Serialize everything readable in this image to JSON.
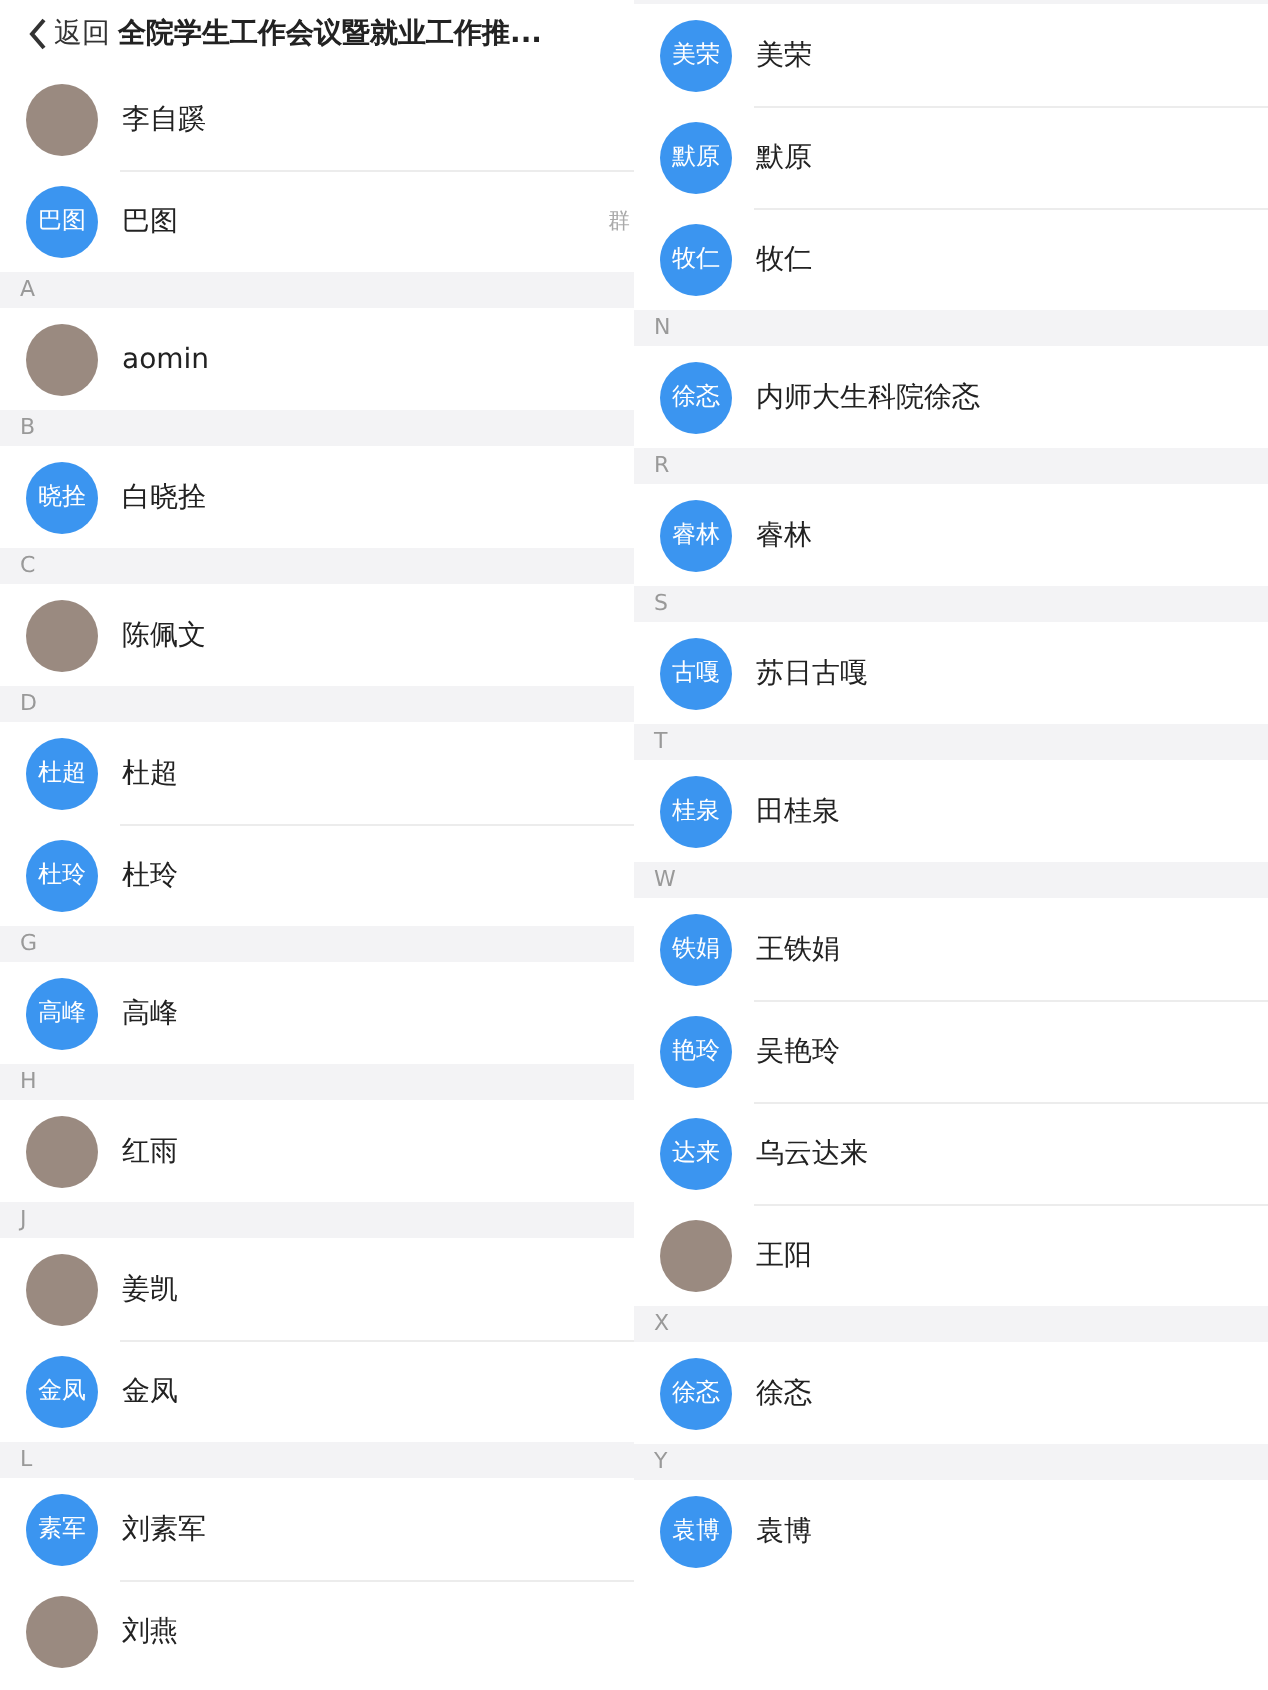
{
  "panels": [
    {
      "header": {
        "back_label": "返回",
        "title": "全院学生工作会议暨就业工作推..."
      },
      "sections": [
        {
          "contacts": [
            {
              "name": "李自蹊",
              "avatar": {
                "kind": "photo"
              }
            },
            {
              "name": "巴图",
              "avatar": {
                "kind": "initials",
                "text": "巴图"
              },
              "side_label": "群"
            }
          ]
        },
        {
          "letter": "A",
          "contacts": [
            {
              "name": "aomin",
              "avatar": {
                "kind": "photo"
              }
            }
          ]
        },
        {
          "letter": "B",
          "contacts": [
            {
              "name": "白晓拴",
              "avatar": {
                "kind": "initials",
                "text": "晓拴"
              }
            }
          ]
        },
        {
          "letter": "C",
          "contacts": [
            {
              "name": "陈佩文",
              "avatar": {
                "kind": "photo"
              }
            }
          ]
        },
        {
          "letter": "D",
          "contacts": [
            {
              "name": "杜超",
              "avatar": {
                "kind": "initials",
                "text": "杜超"
              }
            },
            {
              "name": "杜玲",
              "avatar": {
                "kind": "initials",
                "text": "杜玲"
              }
            }
          ]
        },
        {
          "letter": "G",
          "contacts": [
            {
              "name": "高峰",
              "avatar": {
                "kind": "initials",
                "text": "高峰"
              }
            }
          ]
        },
        {
          "letter": "H",
          "contacts": [
            {
              "name": "红雨",
              "avatar": {
                "kind": "photo"
              }
            }
          ]
        },
        {
          "letter": "J",
          "contacts": [
            {
              "name": "姜凯",
              "avatar": {
                "kind": "photo"
              }
            },
            {
              "name": "金凤",
              "avatar": {
                "kind": "initials",
                "text": "金凤"
              }
            }
          ]
        },
        {
          "letter": "L",
          "contacts": [
            {
              "name": "刘素军",
              "avatar": {
                "kind": "initials",
                "text": "素军"
              }
            },
            {
              "name": "刘燕",
              "avatar": {
                "kind": "photo"
              }
            }
          ]
        }
      ]
    },
    {
      "sections": [
        {
          "contacts": [
            {
              "name": "美荣",
              "avatar": {
                "kind": "initials",
                "text": "美荣"
              }
            },
            {
              "name": "默原",
              "avatar": {
                "kind": "initials",
                "text": "默原"
              }
            },
            {
              "name": "牧仁",
              "avatar": {
                "kind": "initials",
                "text": "牧仁"
              }
            }
          ]
        },
        {
          "letter": "N",
          "contacts": [
            {
              "name": "内师大生科院徐忞",
              "avatar": {
                "kind": "initials",
                "text": "徐忞"
              }
            }
          ]
        },
        {
          "letter": "R",
          "contacts": [
            {
              "name": "睿林",
              "avatar": {
                "kind": "initials",
                "text": "睿林"
              }
            }
          ]
        },
        {
          "letter": "S",
          "contacts": [
            {
              "name": "苏日古嘎",
              "avatar": {
                "kind": "initials",
                "text": "古嘎"
              }
            }
          ]
        },
        {
          "letter": "T",
          "contacts": [
            {
              "name": "田桂泉",
              "avatar": {
                "kind": "initials",
                "text": "桂泉"
              }
            }
          ]
        },
        {
          "letter": "W",
          "contacts": [
            {
              "name": "王铁娟",
              "avatar": {
                "kind": "initials",
                "text": "铁娟"
              }
            },
            {
              "name": "吴艳玲",
              "avatar": {
                "kind": "initials",
                "text": "艳玲"
              }
            },
            {
              "name": "乌云达来",
              "avatar": {
                "kind": "initials",
                "text": "达来"
              }
            },
            {
              "name": "王阳",
              "avatar": {
                "kind": "photo"
              }
            }
          ]
        },
        {
          "letter": "X",
          "contacts": [
            {
              "name": "徐忞",
              "avatar": {
                "kind": "initials",
                "text": "徐忞"
              }
            }
          ]
        },
        {
          "letter": "Y",
          "contacts": [
            {
              "name": "袁博",
              "avatar": {
                "kind": "initials",
                "text": "袁博"
              }
            }
          ]
        }
      ]
    }
  ]
}
